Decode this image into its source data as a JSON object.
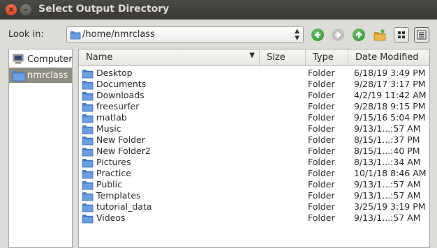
{
  "window": {
    "title": "Select Output Directory",
    "close_glyph": "×",
    "min_glyph": "–"
  },
  "lookin": {
    "label": "Look in:",
    "path": "/home/nmrclass"
  },
  "toolbar": {
    "back_icon": "left-arrow-icon",
    "forward_icon": "right-arrow-icon",
    "up_icon": "up-arrow-icon",
    "new_folder_icon": "new-folder-icon",
    "icon_view_icon": "icon-view-icon",
    "detail_view_icon": "detail-view-icon"
  },
  "sidebar": {
    "items": [
      {
        "label": "Computer",
        "icon": "computer-icon",
        "selected": false
      },
      {
        "label": "nmrclass",
        "icon": "folder-icon",
        "selected": true
      }
    ]
  },
  "columns": {
    "name": "Name",
    "size": "Size",
    "type": "Type",
    "date": "Date Modified"
  },
  "files": [
    {
      "name": "Desktop",
      "type": "Folder",
      "date": "6/18/19 3:49 PM"
    },
    {
      "name": "Documents",
      "type": "Folder",
      "date": "9/28/17 3:17 PM"
    },
    {
      "name": "Downloads",
      "type": "Folder",
      "date": "4/2/19 11:42 AM"
    },
    {
      "name": "freesurfer",
      "type": "Folder",
      "date": "9/28/18 9:15 PM"
    },
    {
      "name": "matlab",
      "type": "Folder",
      "date": "9/15/16 5:04 PM"
    },
    {
      "name": "Music",
      "type": "Folder",
      "date": "9/13/1...:57 AM"
    },
    {
      "name": "New Folder",
      "type": "Folder",
      "date": "8/15/1...:37 PM"
    },
    {
      "name": "New Folder2",
      "type": "Folder",
      "date": "8/15/1...:40 PM"
    },
    {
      "name": "Pictures",
      "type": "Folder",
      "date": "8/13/1...:34 AM"
    },
    {
      "name": "Practice",
      "type": "Folder",
      "date": "10/1/18 8:46 AM"
    },
    {
      "name": "Public",
      "type": "Folder",
      "date": "9/13/1...:57 AM"
    },
    {
      "name": "Templates",
      "type": "Folder",
      "date": "9/13/1...:57 AM"
    },
    {
      "name": "tutorial_data",
      "type": "Folder",
      "date": "3/25/19 3:19 PM"
    },
    {
      "name": "Videos",
      "type": "Folder",
      "date": "9/13/1...:57 AM"
    }
  ],
  "colors": {
    "folder": "#5b8fd6",
    "nav_green": "#3e9a3a",
    "nav_disabled": "#b9b8b4",
    "selection": "#8e8b80"
  }
}
